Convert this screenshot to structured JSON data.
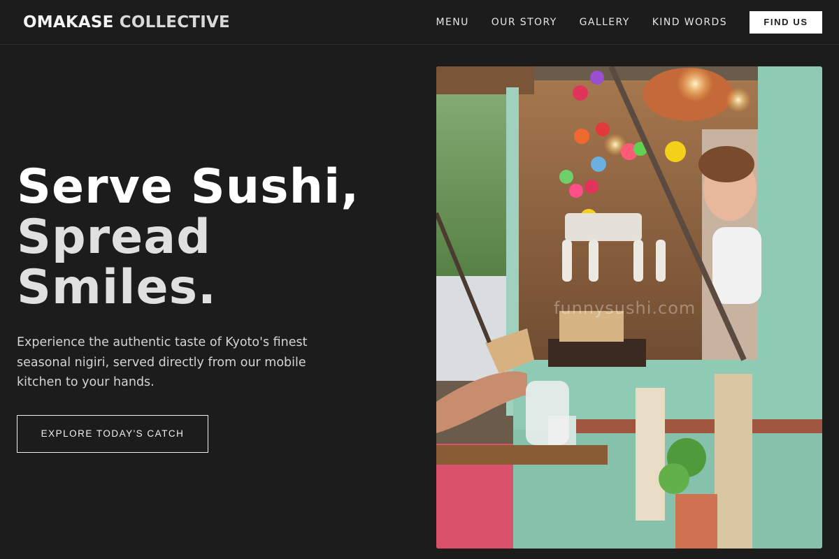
{
  "brand": {
    "primary": "OMAKASE",
    "secondary": "COLLECTIVE"
  },
  "nav": {
    "links": [
      "MENU",
      "OUR STORY",
      "GALLERY",
      "KIND WORDS"
    ],
    "cta": "FIND US"
  },
  "hero": {
    "headline_line1": "Serve Sushi,",
    "headline_line2": "Spread",
    "headline_line3": "Smiles.",
    "subtext": "Experience the authentic taste of Kyoto's finest seasonal nigiri, served directly from our mobile kitchen to your hands.",
    "cta": "EXPLORE TODAY'S CATCH"
  },
  "photo": {
    "watermark": "funnysushi.com",
    "subject": "food-truck-photo"
  },
  "colors": {
    "background": "#1c1c1c",
    "text": "#f2f2f2",
    "button_bg": "#ffffff",
    "truck_mint": "#8fcab5"
  }
}
